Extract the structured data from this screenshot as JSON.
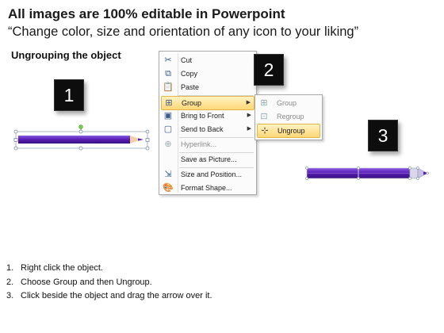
{
  "header": {
    "title": "All images are 100% editable in Powerpoint",
    "subtitle": "“Change color, size and orientation of any icon to your liking”"
  },
  "section_label": "Ungrouping the object",
  "steps_boxes": [
    "1",
    "2",
    "3"
  ],
  "context_menu": {
    "items": [
      {
        "label": "Cut",
        "icon": "scissors-icon"
      },
      {
        "label": "Copy",
        "icon": "copy-icon"
      },
      {
        "label": "Paste",
        "icon": "paste-icon"
      },
      {
        "label": "Group",
        "icon": "group-icon",
        "submenu": true,
        "highlighted": true
      },
      {
        "label": "Bring to Front",
        "icon": "bring-to-front-icon",
        "submenu": true
      },
      {
        "label": "Send to Back",
        "icon": "send-to-back-icon",
        "submenu": true
      },
      {
        "label": "Hyperlink...",
        "icon": "hyperlink-icon",
        "disabled": true
      },
      {
        "label": "Save as Picture...",
        "icon": "none"
      },
      {
        "label": "Size and Position...",
        "icon": "size-position-icon"
      },
      {
        "label": "Format Shape...",
        "icon": "format-shape-icon"
      }
    ]
  },
  "submenu": {
    "items": [
      {
        "label": "Group",
        "icon": "group-icon",
        "disabled": true
      },
      {
        "label": "Regroup",
        "icon": "regroup-icon",
        "disabled": true
      },
      {
        "label": "Ungroup",
        "icon": "ungroup-icon",
        "highlighted": true
      }
    ]
  },
  "instructions": [
    {
      "num": "1.",
      "text": "Right click the object."
    },
    {
      "num": "2.",
      "text": "Choose Group and then Ungroup."
    },
    {
      "num": "3.",
      "text": "Click beside the object and drag the arrow over it."
    }
  ],
  "colors": {
    "pencil_body": "#5b1fb8",
    "pencil_light": "#8a5be0",
    "highlight": "#ffd777",
    "step_box": "#0d0d0d"
  }
}
